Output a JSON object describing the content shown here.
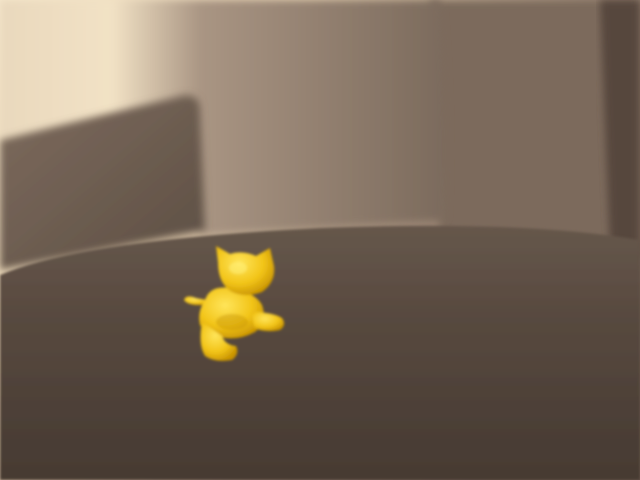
{
  "scene": {
    "subject": "kitten-figurine",
    "setting": "sofa",
    "colors": {
      "figurine_yellow": "#f2c418",
      "figurine_highlight": "#ffe55a",
      "figurine_shadow": "#c79200",
      "sofa_dark": "#4f4038",
      "sofa_mid": "#6e5d50",
      "sofa_light": "#cdb79f",
      "sunlit_wall": "#f3e2c3"
    }
  }
}
